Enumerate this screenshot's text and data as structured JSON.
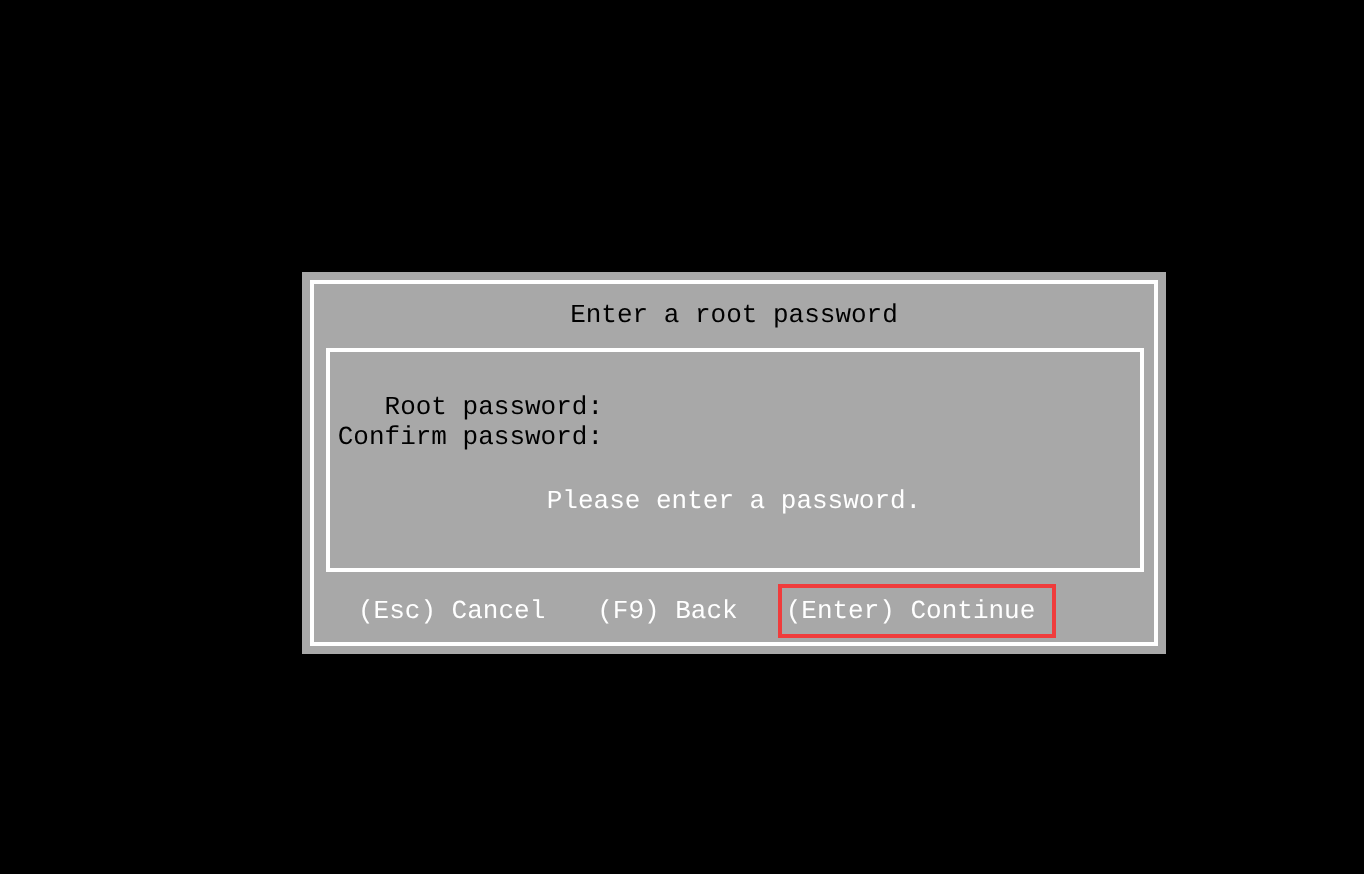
{
  "dialog": {
    "title": "Enter a root password",
    "fields": [
      {
        "label": "Root password:"
      },
      {
        "label": "Confirm password:"
      }
    ],
    "message": "Please enter a password.",
    "actions": [
      {
        "label": "(Esc) Cancel",
        "annotated": false
      },
      {
        "label": "(F9) Back",
        "annotated": false
      },
      {
        "label": "(Enter) Continue",
        "annotated": true
      }
    ]
  }
}
